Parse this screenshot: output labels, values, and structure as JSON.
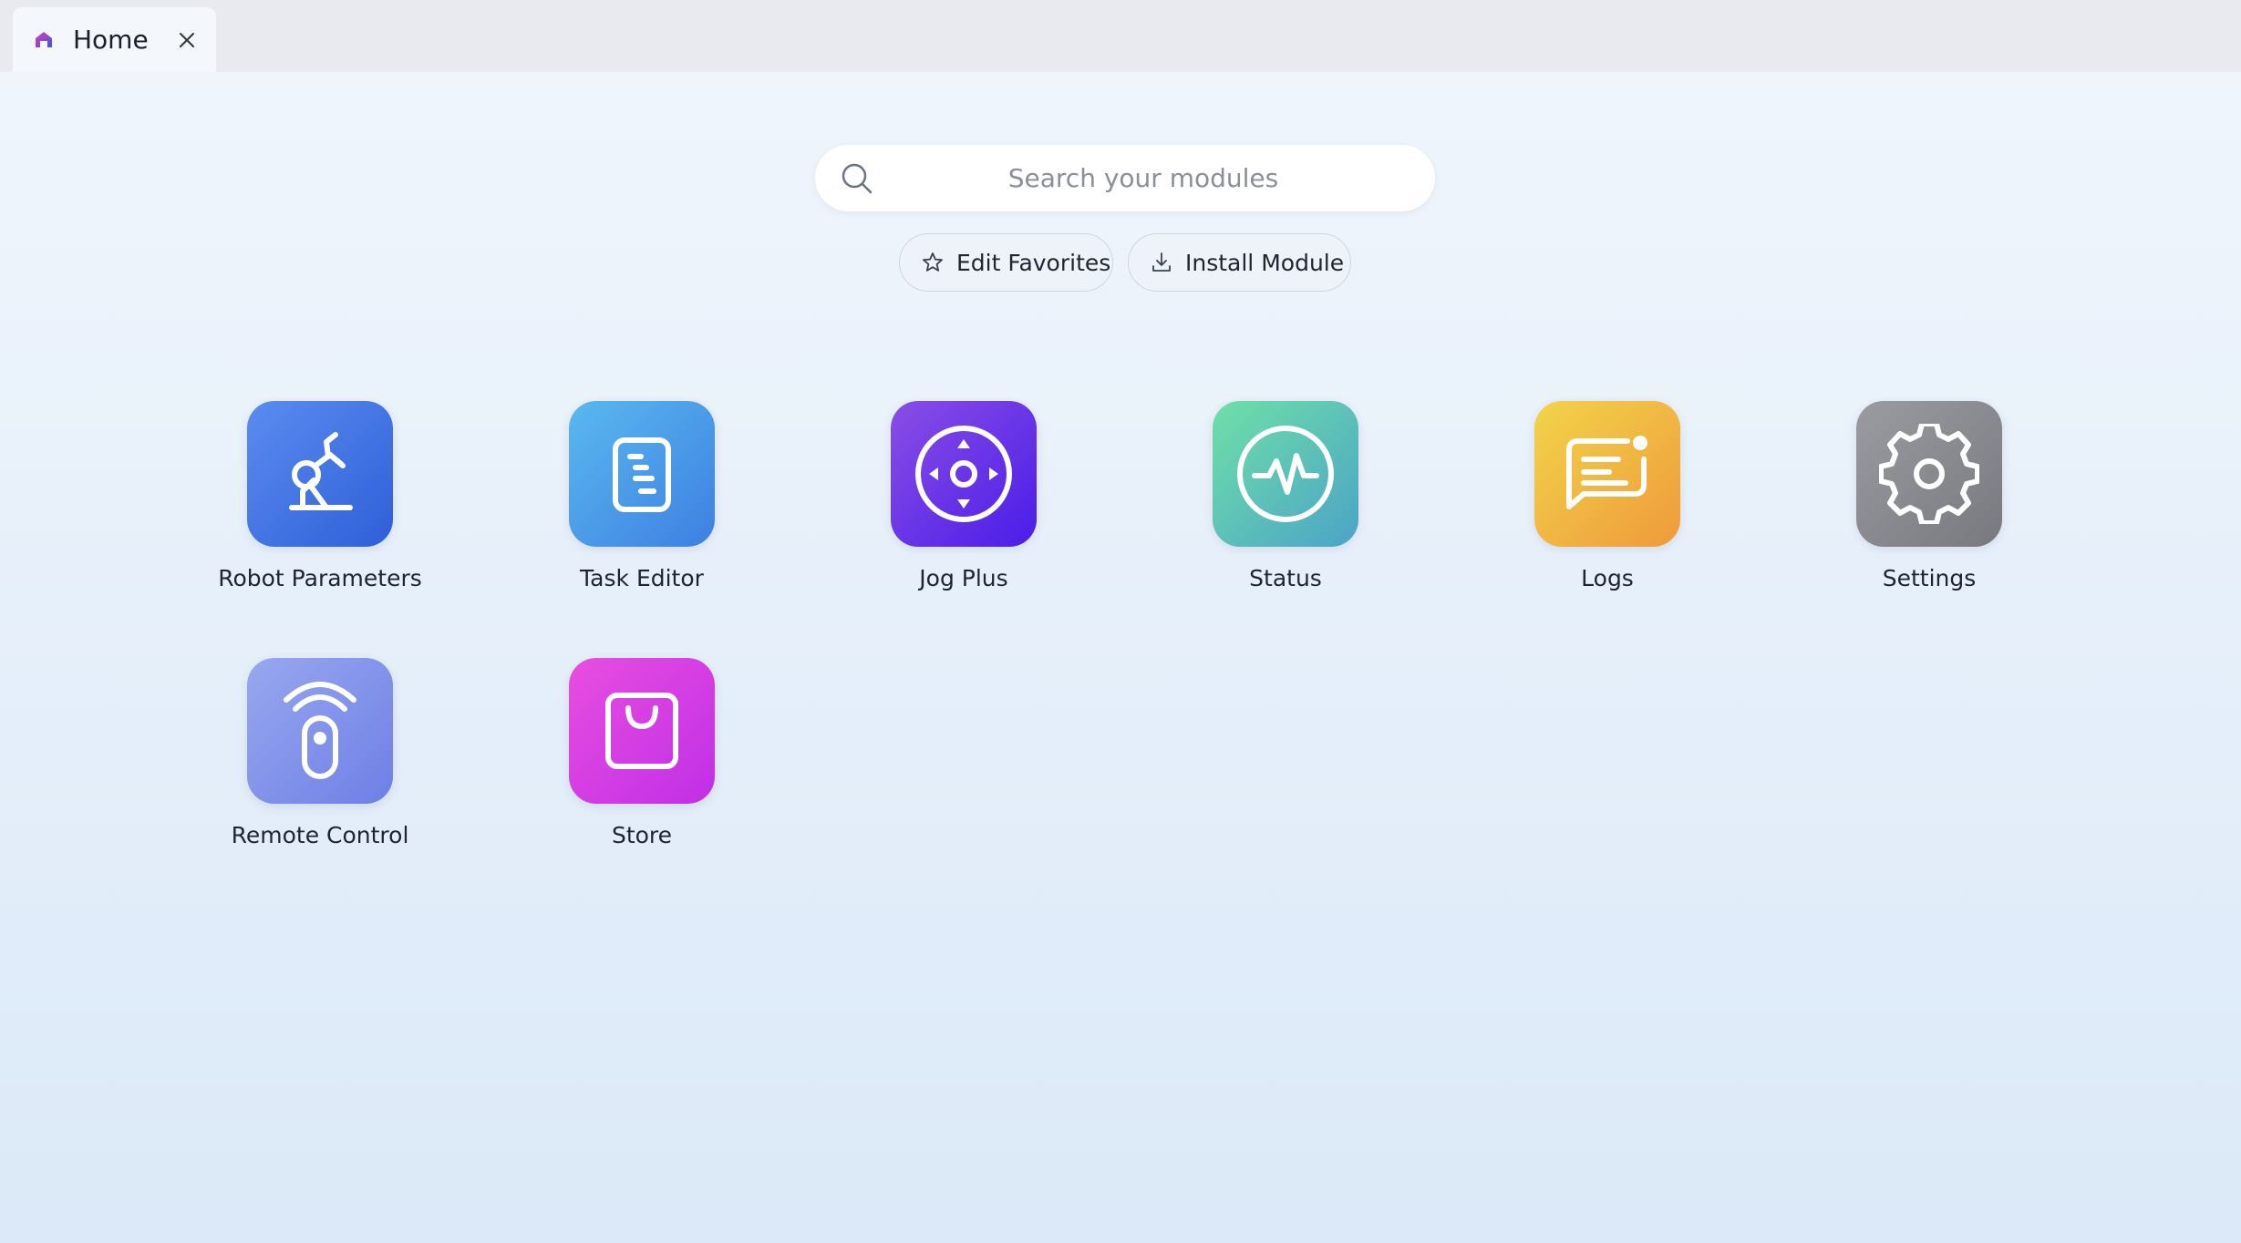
{
  "tab": {
    "title": "Home",
    "icon": "home-icon",
    "close_icon": "close-icon"
  },
  "search": {
    "placeholder": "Search your modules",
    "value": ""
  },
  "actions": {
    "edit_favorites": {
      "label": "Edit Favorites",
      "icon": "star-icon"
    },
    "install_module": {
      "label": "Install Module",
      "icon": "download-icon"
    }
  },
  "modules": [
    {
      "label": "Robot Parameters",
      "icon": "robot-arm-icon",
      "colors": [
        "#5b8cf0",
        "#2e5fd8"
      ]
    },
    {
      "label": "Task Editor",
      "icon": "task-editor-icon",
      "colors": [
        "#5ab9ee",
        "#3d7fe2"
      ]
    },
    {
      "label": "Jog Plus",
      "icon": "jog-icon",
      "colors": [
        "#8a4ee6",
        "#4a1de8"
      ]
    },
    {
      "label": "Status",
      "icon": "status-pulse-icon",
      "colors": [
        "#6fe0a8",
        "#4ba3c7"
      ]
    },
    {
      "label": "Logs",
      "icon": "logs-chat-icon",
      "colors": [
        "#f2d44a",
        "#ef9a3b"
      ]
    },
    {
      "label": "Settings",
      "icon": "gear-icon",
      "colors": [
        "#9a9ca2",
        "#77797f"
      ]
    },
    {
      "label": "Remote Control",
      "icon": "remote-control-icon",
      "colors": [
        "#98a8ef",
        "#6e7fe6"
      ]
    },
    {
      "label": "Store",
      "icon": "shopping-bag-icon",
      "colors": [
        "#e84ee0",
        "#c02fe6"
      ]
    }
  ]
}
